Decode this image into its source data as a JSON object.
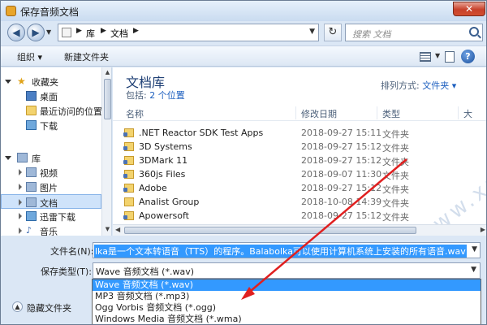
{
  "window": {
    "title": "保存音频文档",
    "close_glyph": "✕"
  },
  "address": {
    "crumbs": [
      "库",
      "文档"
    ],
    "search_placeholder": "搜索 文档"
  },
  "toolbar": {
    "organize_label": "组织 ▾",
    "new_folder_label": "新建文件夹",
    "help_glyph": "?"
  },
  "sidebar": {
    "items": [
      {
        "label": "收藏夹",
        "icon": "star-icon"
      },
      {
        "label": "桌面",
        "icon": "desktop-icon"
      },
      {
        "label": "最近访问的位置",
        "icon": "recent-places-icon"
      },
      {
        "label": "下载",
        "icon": "downloads-icon"
      },
      {
        "label": "库",
        "icon": "library-icon"
      },
      {
        "label": "视频",
        "icon": "video-icon"
      },
      {
        "label": "图片",
        "icon": "pictures-icon"
      },
      {
        "label": "文档",
        "icon": "documents-icon"
      },
      {
        "label": "迅雷下载",
        "icon": "xunlei-download-icon"
      },
      {
        "label": "音乐",
        "icon": "music-icon"
      }
    ]
  },
  "main": {
    "library_title": "文档库",
    "includes_label": "包括: ",
    "includes_link": "2 个位置",
    "arrange_label": "排列方式: ",
    "arrange_value": "文件夹 ▾",
    "columns": [
      "名称",
      "修改日期",
      "类型",
      "大"
    ],
    "files": [
      {
        "name": ".NET Reactor SDK Test Apps",
        "date": "2018-09-27 15:11",
        "type": "文件夹"
      },
      {
        "name": "3D Systems",
        "date": "2018-09-27 15:12",
        "type": "文件夹"
      },
      {
        "name": "3DMark 11",
        "date": "2018-09-27 15:12",
        "type": "文件夹"
      },
      {
        "name": "360js Files",
        "date": "2018-09-07 11:30",
        "type": "文件夹"
      },
      {
        "name": "Adobe",
        "date": "2018-09-27 15:12",
        "type": "文件夹"
      },
      {
        "name": "Analist Group",
        "date": "2018-10-08 14:39",
        "type": "文件夹"
      },
      {
        "name": "Apowersoft",
        "date": "2018-09-27 15:12",
        "type": "文件夹"
      }
    ],
    "watermark": "软件学堂 www.xue51.com"
  },
  "form": {
    "filename_label": "文件名(N):",
    "filename_value": "lka是一个文本转语音（TTS）的程序。Balabolka可以使用计算机系统上安装的所有语音.wav",
    "filetype_label": "保存类型(T):",
    "filetype_value": "Wave 音频文档 (*.wav)",
    "hide_folders_label": "隐藏文件夹",
    "type_options": [
      "Wave 音频文档 (*.wav)",
      "MP3 音频文档 (*.mp3)",
      "Ogg Vorbis 音频文档 (*.ogg)",
      "Windows Media 音频文档 (*.wma)"
    ],
    "selected_option_index": 0
  },
  "colors": {
    "selection": "#3399ff",
    "annotation_arrow": "#e02020",
    "link": "#1d5fbf"
  }
}
